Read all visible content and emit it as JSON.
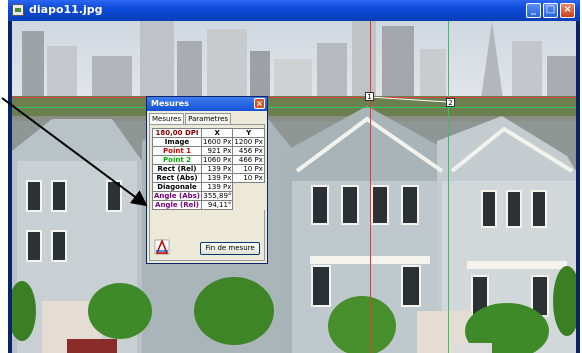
{
  "window": {
    "title": "diapo11.jpg",
    "min_glyph": "_",
    "max_glyph": "□",
    "close_glyph": "×"
  },
  "overlay": {
    "marker1": "1",
    "marker2": "2"
  },
  "dialog": {
    "title": "Mesures",
    "close_glyph": "×",
    "tabs": [
      "Mesures",
      "Parametres"
    ],
    "table": {
      "header": {
        "dpi": "180,00 DPI",
        "x": "X",
        "y": "Y"
      },
      "rows": [
        {
          "label": "Image",
          "x": "1600 Px",
          "y": "1200 Px",
          "color": "#000000"
        },
        {
          "label": "Point 1",
          "x": "921 Px",
          "y": "456 Px",
          "color": "#d00000"
        },
        {
          "label": "Point 2",
          "x": "1060 Px",
          "y": "466 Px",
          "color": "#00b000"
        },
        {
          "label": "Rect (Rel)",
          "x": "139 Px",
          "y": "10 Px",
          "color": "#000000"
        },
        {
          "label": "Rect (Abs)",
          "x": "139 Px",
          "y": "10 Px",
          "color": "#000000"
        },
        {
          "label": "Diagonale",
          "x": "139 Px",
          "y": "",
          "color": "#000000"
        },
        {
          "label": "Angle (Abs)",
          "x": "355,89°",
          "y": "",
          "color": "#7a0080"
        },
        {
          "label": "Angle (Rel)",
          "x": "94,11°",
          "y": "",
          "color": "#7a0080"
        }
      ]
    },
    "finish_button": "Fin de mesure"
  },
  "colors": {
    "dpi_text": "#8b0000",
    "point1_line": "#e03a3a",
    "point2_line": "#39c25a",
    "arrow": "#000000"
  }
}
